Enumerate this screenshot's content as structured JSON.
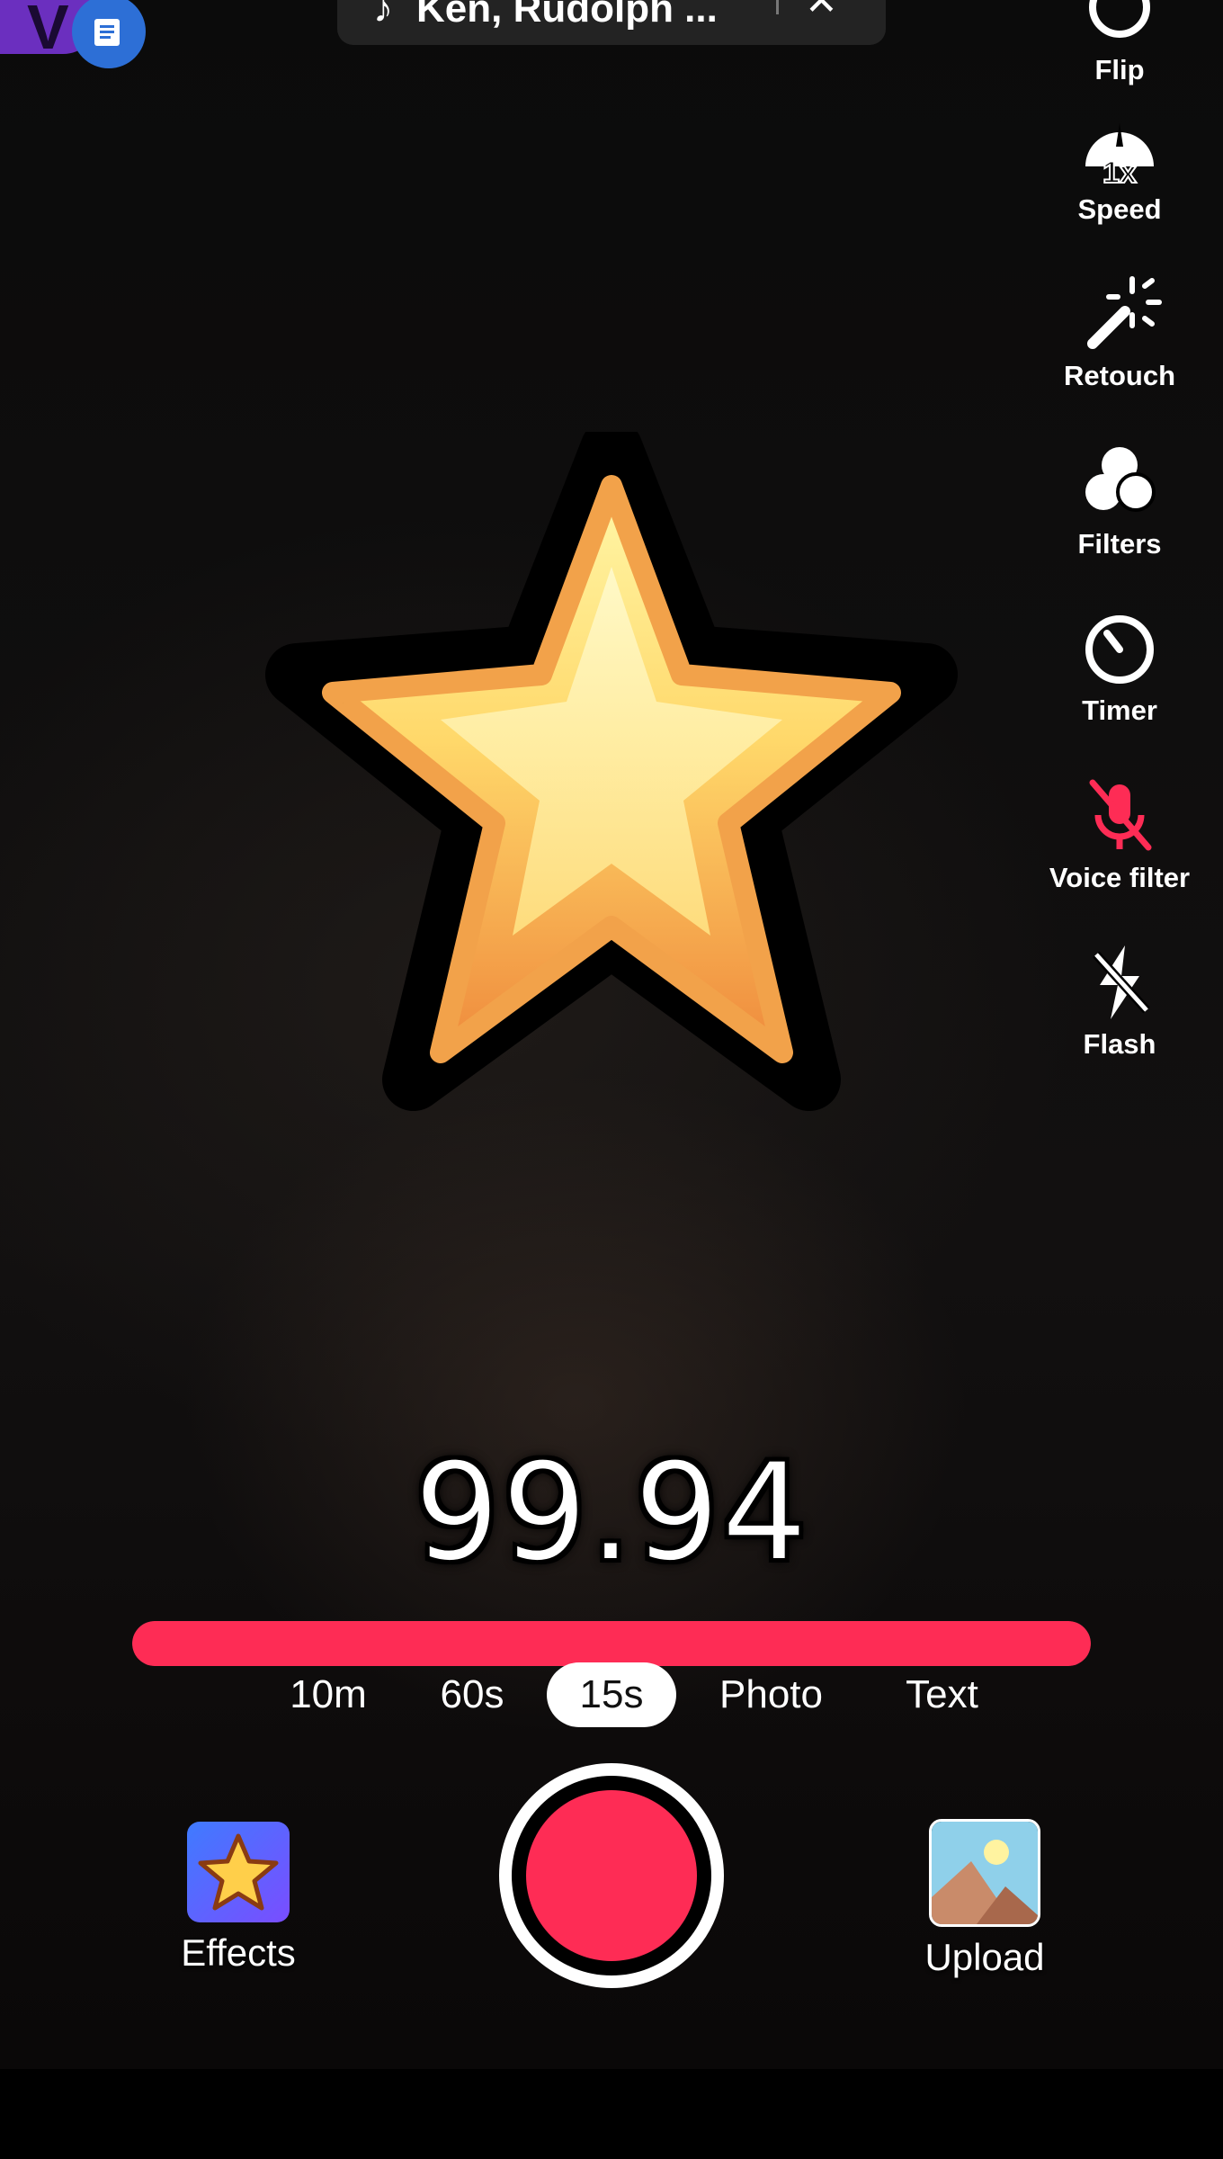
{
  "top": {
    "music": {
      "title": "Ken, Rudolph ..."
    }
  },
  "tools": [
    {
      "label": "Flip",
      "icon": "flip-icon"
    },
    {
      "label": "Speed",
      "icon": "speed-icon",
      "badge": "1x"
    },
    {
      "label": "Retouch",
      "icon": "retouch-icon"
    },
    {
      "label": "Filters",
      "icon": "filters-icon"
    },
    {
      "label": "Timer",
      "icon": "timer-icon"
    },
    {
      "label": "Voice filter",
      "icon": "mic-off-icon",
      "color": "#fe2c55"
    },
    {
      "label": "Flash",
      "icon": "flash-off-icon"
    }
  ],
  "timer": {
    "value": "99.94"
  },
  "progress": {
    "fraction": 1.0,
    "color": "#fe2c55"
  },
  "modes": [
    {
      "label": "10m",
      "active": false
    },
    {
      "label": "60s",
      "active": false
    },
    {
      "label": "15s",
      "active": true
    },
    {
      "label": "Photo",
      "active": false
    },
    {
      "label": "Text",
      "active": false
    }
  ],
  "record": {
    "color": "#fe2c55"
  },
  "effects": {
    "label": "Effects"
  },
  "upload": {
    "label": "Upload"
  }
}
